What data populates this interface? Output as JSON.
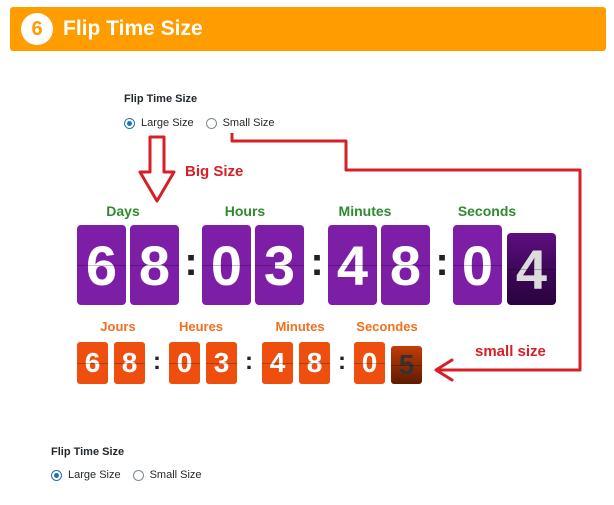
{
  "banner": {
    "number": "6",
    "title": "Flip Time Size"
  },
  "setting_top": {
    "label": "Flip Time Size",
    "options": [
      {
        "label": "Large Size",
        "checked": true
      },
      {
        "label": "Small Size",
        "checked": false
      }
    ]
  },
  "setting_bottom": {
    "label": "Flip Time Size",
    "options": [
      {
        "label": "Large Size",
        "checked": true
      },
      {
        "label": "Small Size",
        "checked": false
      }
    ]
  },
  "annotations": {
    "big": "Big Size",
    "small": "small size"
  },
  "big_clock": {
    "labels": [
      "Days",
      "Hours",
      "Minutes",
      "Seconds"
    ],
    "digits": [
      "6",
      "8",
      "0",
      "3",
      "4",
      "8",
      "0",
      "4"
    ],
    "separator": ":"
  },
  "small_clock": {
    "labels": [
      "Jours",
      "Heures",
      "Minutes",
      "Secondes"
    ],
    "digits": [
      "6",
      "8",
      "0",
      "3",
      "4",
      "8",
      "0",
      "5"
    ],
    "separator": ":"
  },
  "colors": {
    "banner": "#ff9c00",
    "big_digit_bg": "#7d1fa6",
    "small_digit_bg": "#ee4f0f",
    "big_label": "#2f8a2f",
    "small_label": "#f26f1f",
    "annotation": "#d61f26"
  }
}
